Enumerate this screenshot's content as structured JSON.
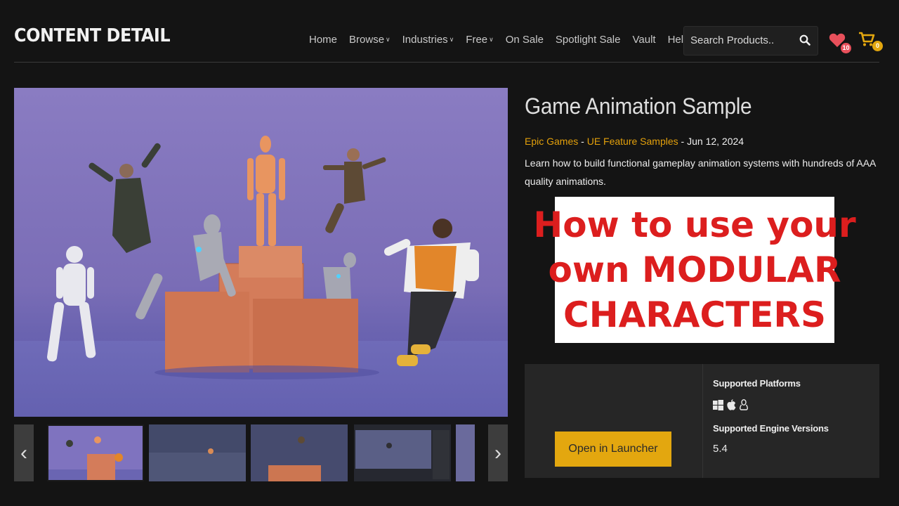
{
  "header": {
    "brand": "CONTENT DETAIL",
    "nav": [
      {
        "label": "Home",
        "dropdown": false
      },
      {
        "label": "Browse",
        "dropdown": true
      },
      {
        "label": "Industries",
        "dropdown": true
      },
      {
        "label": "Free",
        "dropdown": true
      },
      {
        "label": "On Sale",
        "dropdown": false
      },
      {
        "label": "Spotlight Sale",
        "dropdown": false
      },
      {
        "label": "Vault",
        "dropdown": false
      },
      {
        "label": "Help",
        "dropdown": false
      }
    ],
    "search_placeholder": "Search Products..",
    "wishlist_count": "10",
    "cart_count": "0"
  },
  "product": {
    "title": "Game Animation Sample",
    "seller": "Epic Games",
    "category": "UE Feature Samples",
    "date": "Jun 12, 2024",
    "description": "Learn how to build functional gameplay animation systems with hundreds of AAA quality animations."
  },
  "overlay": {
    "line1": "How to use your",
    "line2": "own MODULAR",
    "line3": "CHARACTERS"
  },
  "panel": {
    "button": "Open in Launcher",
    "platforms_label": "Supported Platforms",
    "platforms": [
      "windows-icon",
      "apple-icon",
      "linux-icon"
    ],
    "engine_label": "Supported Engine Versions",
    "engine_version": "5.4"
  },
  "colors": {
    "accent": "#e3a70f",
    "link": "#e3a00b",
    "badge": "#e8505b",
    "overlay_text": "#dc1e1e"
  }
}
